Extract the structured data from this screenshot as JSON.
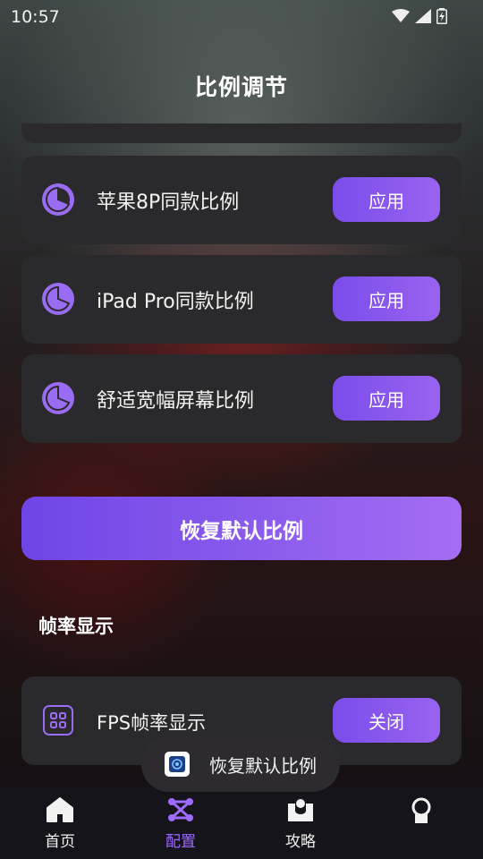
{
  "status_bar": {
    "time": "10:57"
  },
  "header": {
    "title": "比例调节"
  },
  "ratio_presets": [
    {
      "label": "苹果8P同款比例",
      "button": "应用"
    },
    {
      "label": "iPad Pro同款比例",
      "button": "应用"
    },
    {
      "label": "舒适宽幅屏幕比例",
      "button": "应用"
    }
  ],
  "restore_button": {
    "label": "恢复默认比例"
  },
  "fps_section": {
    "title": "帧率显示",
    "item_label": "FPS帧率显示",
    "button": "关闭"
  },
  "toast": {
    "text": "恢复默认比例"
  },
  "bottom_nav": {
    "items": [
      {
        "label": "首页",
        "icon": "home-icon"
      },
      {
        "label": "配置",
        "icon": "config-icon",
        "active": true
      },
      {
        "label": "攻略",
        "icon": "guide-icon"
      },
      {
        "label": "",
        "icon": "profile-icon"
      }
    ]
  },
  "colors": {
    "accent": "#8a57ee",
    "accent_light": "#a46df2",
    "card_bg": "#2a2a2c",
    "nav_bg": "#15141a",
    "active_nav": "#9d6bff"
  }
}
